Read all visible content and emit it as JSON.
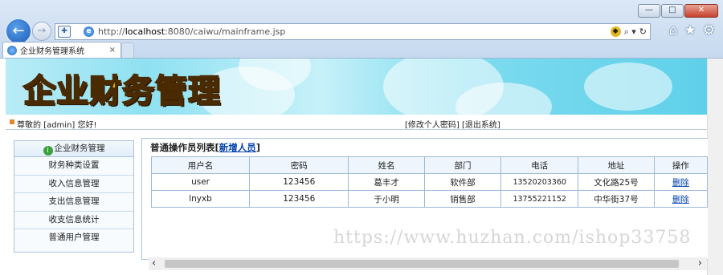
{
  "browser": {
    "window_controls": {
      "minimize": "—",
      "maximize": "□",
      "close": "✕"
    },
    "address": {
      "prefix": "http://",
      "host": "localhost",
      "rest": ":8080/caiwu/mainframe.jsp",
      "search_icon": "⌕ ▾",
      "refresh": "↻"
    },
    "toolbar_icons": {
      "home": "⌂",
      "favorites": "★",
      "tools": "⚙"
    },
    "tab": {
      "title": "企业财务管理系统",
      "close": "×"
    }
  },
  "banner": {
    "title": "企业财务管理"
  },
  "userbar": {
    "greeting": "尊敬的 [admin] 您好!",
    "links": "[修改个人密码] [退出系统]"
  },
  "sidebar": {
    "header": "企业财务管理",
    "items": [
      {
        "label": "财务种类设置"
      },
      {
        "label": "收入信息管理"
      },
      {
        "label": "支出信息管理"
      },
      {
        "label": "收支信息统计"
      },
      {
        "label": "普通用户管理"
      }
    ]
  },
  "panel": {
    "title_prefix": "普通操作员列表[",
    "title_link": "新增人员",
    "title_suffix": "]",
    "columns": [
      "用户名",
      "密码",
      "姓名",
      "部门",
      "电话",
      "地址",
      "操作"
    ],
    "rows": [
      {
        "username": "user",
        "password": "123456",
        "name": "葛丰才",
        "dept": "软件部",
        "phone": "13520203360",
        "address": "文化路25号",
        "action": "删除"
      },
      {
        "username": "lnyxb",
        "password": "123456",
        "name": "于小明",
        "dept": "销售部",
        "phone": "13755221152",
        "address": "中华街37号",
        "action": "删除"
      }
    ]
  },
  "watermark": "https://www.huzhan.com/ishop33758",
  "scrollbar": {
    "left": "‹",
    "right": "›"
  }
}
